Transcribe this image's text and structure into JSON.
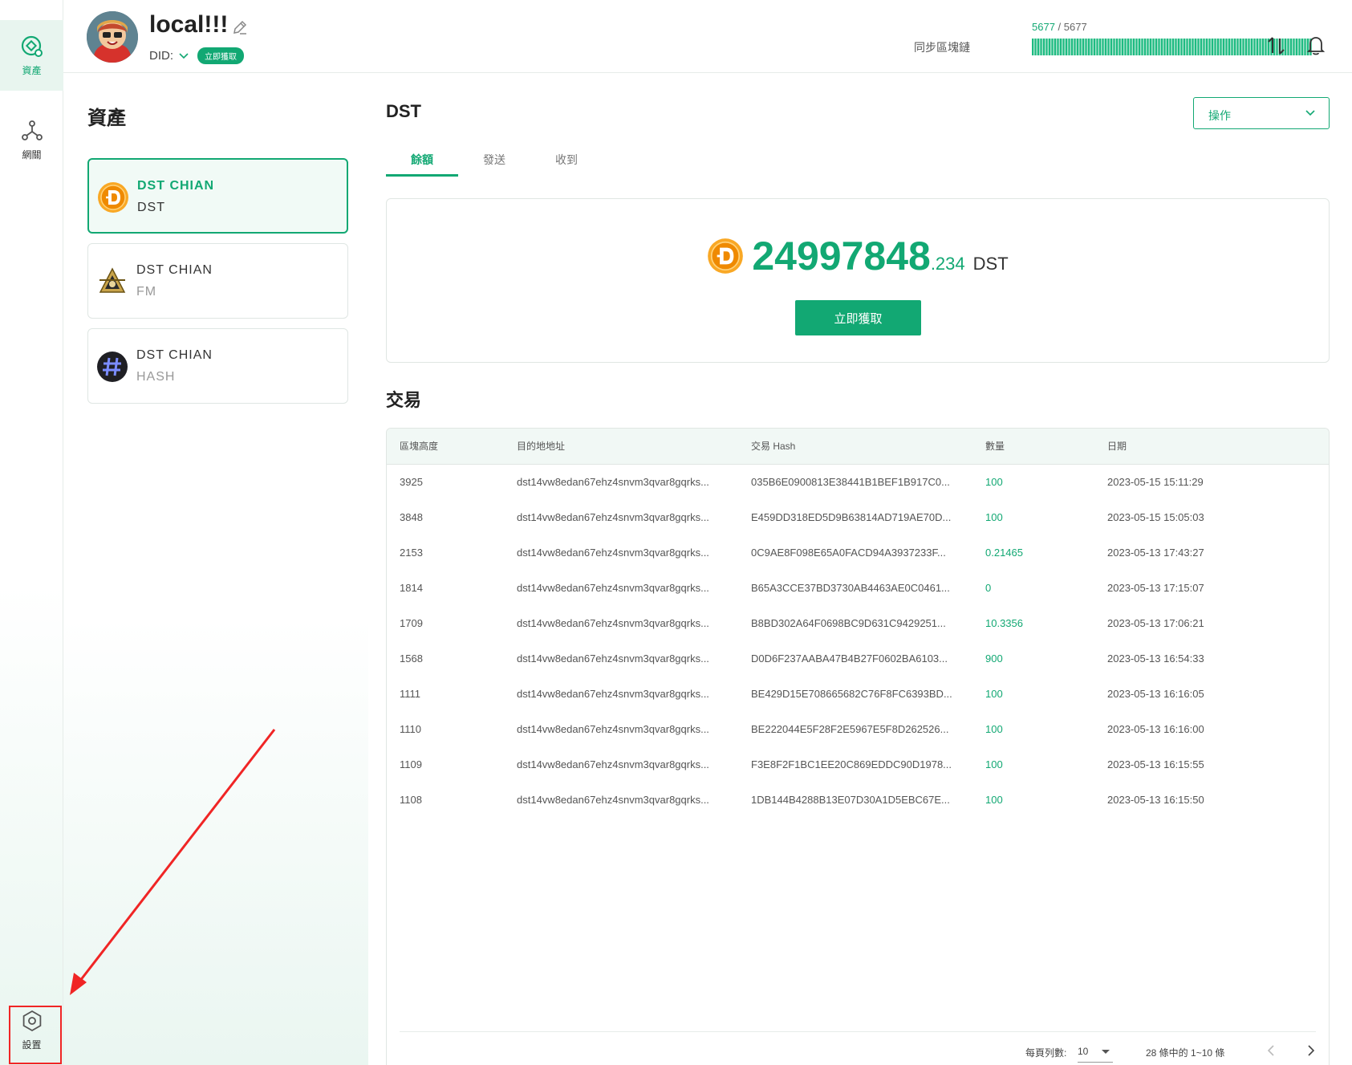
{
  "rail": {
    "items": [
      {
        "label": "資產",
        "icon": "assets-icon"
      },
      {
        "label": "網關",
        "icon": "network-icon"
      },
      {
        "label": "設置",
        "icon": "settings-icon"
      }
    ]
  },
  "header": {
    "title": "local!!!",
    "did_label": "DID:",
    "did_badge": "立即獲取",
    "sync_current": "5677",
    "sync_separator": "/",
    "sync_total": "5677",
    "sync_label": "同步區塊鏈",
    "sync_progress": 1.0
  },
  "assets": {
    "heading": "資產",
    "items": [
      {
        "name": "DST CHIAN",
        "symbol": "DST",
        "icon": "dst-coin-icon",
        "active": true
      },
      {
        "name": "DST CHIAN",
        "symbol": "FM",
        "icon": "fm-coin-icon",
        "active": false
      },
      {
        "name": "DST CHIAN",
        "symbol": "HASH",
        "icon": "hash-coin-icon",
        "active": false
      }
    ]
  },
  "detail": {
    "title": "DST",
    "ops_label": "操作",
    "tabs": [
      "餘額",
      "發送",
      "收到"
    ],
    "balance_int": "24997848",
    "balance_dec": ".234",
    "balance_unit": "DST",
    "claim_label": "立即獲取"
  },
  "transactions": {
    "heading": "交易",
    "columns": [
      "區塊高度",
      "目的地地址",
      "交易 Hash",
      "數量",
      "日期"
    ],
    "rows": [
      [
        "3925",
        "dst14vw8edan67ehz4snvm3qvar8gqrks...",
        "035B6E0900813E38441B1BEF1B917C0...",
        "100",
        "2023-05-15 15:11:29"
      ],
      [
        "3848",
        "dst14vw8edan67ehz4snvm3qvar8gqrks...",
        "E459DD318ED5D9B63814AD719AE70D...",
        "100",
        "2023-05-15 15:05:03"
      ],
      [
        "2153",
        "dst14vw8edan67ehz4snvm3qvar8gqrks...",
        "0C9AE8F098E65A0FACD94A3937233F...",
        "0.21465",
        "2023-05-13 17:43:27"
      ],
      [
        "1814",
        "dst14vw8edan67ehz4snvm3qvar8gqrks...",
        "B65A3CCE37BD3730AB4463AE0C0461...",
        "0",
        "2023-05-13 17:15:07"
      ],
      [
        "1709",
        "dst14vw8edan67ehz4snvm3qvar8gqrks...",
        "B8BD302A64F0698BC9D631C9429251...",
        "10.3356",
        "2023-05-13 17:06:21"
      ],
      [
        "1568",
        "dst14vw8edan67ehz4snvm3qvar8gqrks...",
        "D0D6F237AABA47B4B27F0602BA6103...",
        "900",
        "2023-05-13 16:54:33"
      ],
      [
        "1111",
        "dst14vw8edan67ehz4snvm3qvar8gqrks...",
        "BE429D15E708665682C76F8FC6393BD...",
        "100",
        "2023-05-13 16:16:05"
      ],
      [
        "1110",
        "dst14vw8edan67ehz4snvm3qvar8gqrks...",
        "BE222044E5F28F2E5967E5F8D262526...",
        "100",
        "2023-05-13 16:16:00"
      ],
      [
        "1109",
        "dst14vw8edan67ehz4snvm3qvar8gqrks...",
        "F3E8F2F1BC1EE20C869EDDC90D1978...",
        "100",
        "2023-05-13 16:15:55"
      ],
      [
        "1108",
        "dst14vw8edan67ehz4snvm3qvar8gqrks...",
        "1DB144B4288B13E07D30A1D5EBC67E...",
        "100",
        "2023-05-13 16:15:50"
      ]
    ],
    "pager": {
      "per_page_label": "每頁列數:",
      "per_page_value": "10",
      "range_text": "28 條中的 1~10 條"
    }
  },
  "colors": {
    "accent": "#12a873",
    "annotation": "#f02525"
  }
}
